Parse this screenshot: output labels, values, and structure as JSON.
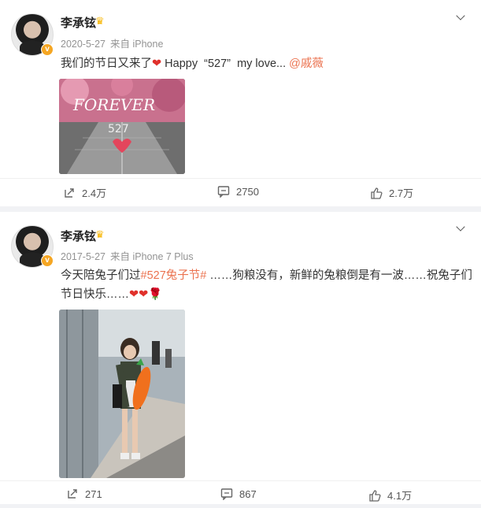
{
  "posts": [
    {
      "author": "李承铉",
      "date": "2020-5-27",
      "source": "来自 iPhone",
      "text_before": "我们的节日又来了",
      "heart": "❤",
      "text_middle": " Happy  “527”  my love... ",
      "mention": "@戚薇",
      "image_text": {
        "word": "FOREVER",
        "number": "527"
      },
      "actions": {
        "share": "2.4万",
        "comment": "2750",
        "like": "2.7万"
      }
    },
    {
      "author": "李承铉",
      "date": "2017-5-27",
      "source": "来自 iPhone 7 Plus",
      "text_line1_before": "今天陪兔子们过",
      "hashtag": "#527兔子节#",
      "text_line1_after": " ……狗粮没有，新鲜的兔粮倒是有一波……祝兔子们",
      "text_line2": "节日快乐……",
      "emoji": "❤❤🌹",
      "actions": {
        "share": "271",
        "comment": "867",
        "like": "4.1万"
      }
    }
  ],
  "colors": {
    "link": "#eb7350",
    "heart": "#e0302b",
    "crown": "#f7b500",
    "verified": "#f5a623"
  },
  "icons": {
    "share": "share-icon",
    "comment": "comment-icon",
    "like": "thumbs-up-icon",
    "menu": "chevron-down-icon",
    "crown": "crown-icon",
    "verified": "verified-badge-icon"
  }
}
